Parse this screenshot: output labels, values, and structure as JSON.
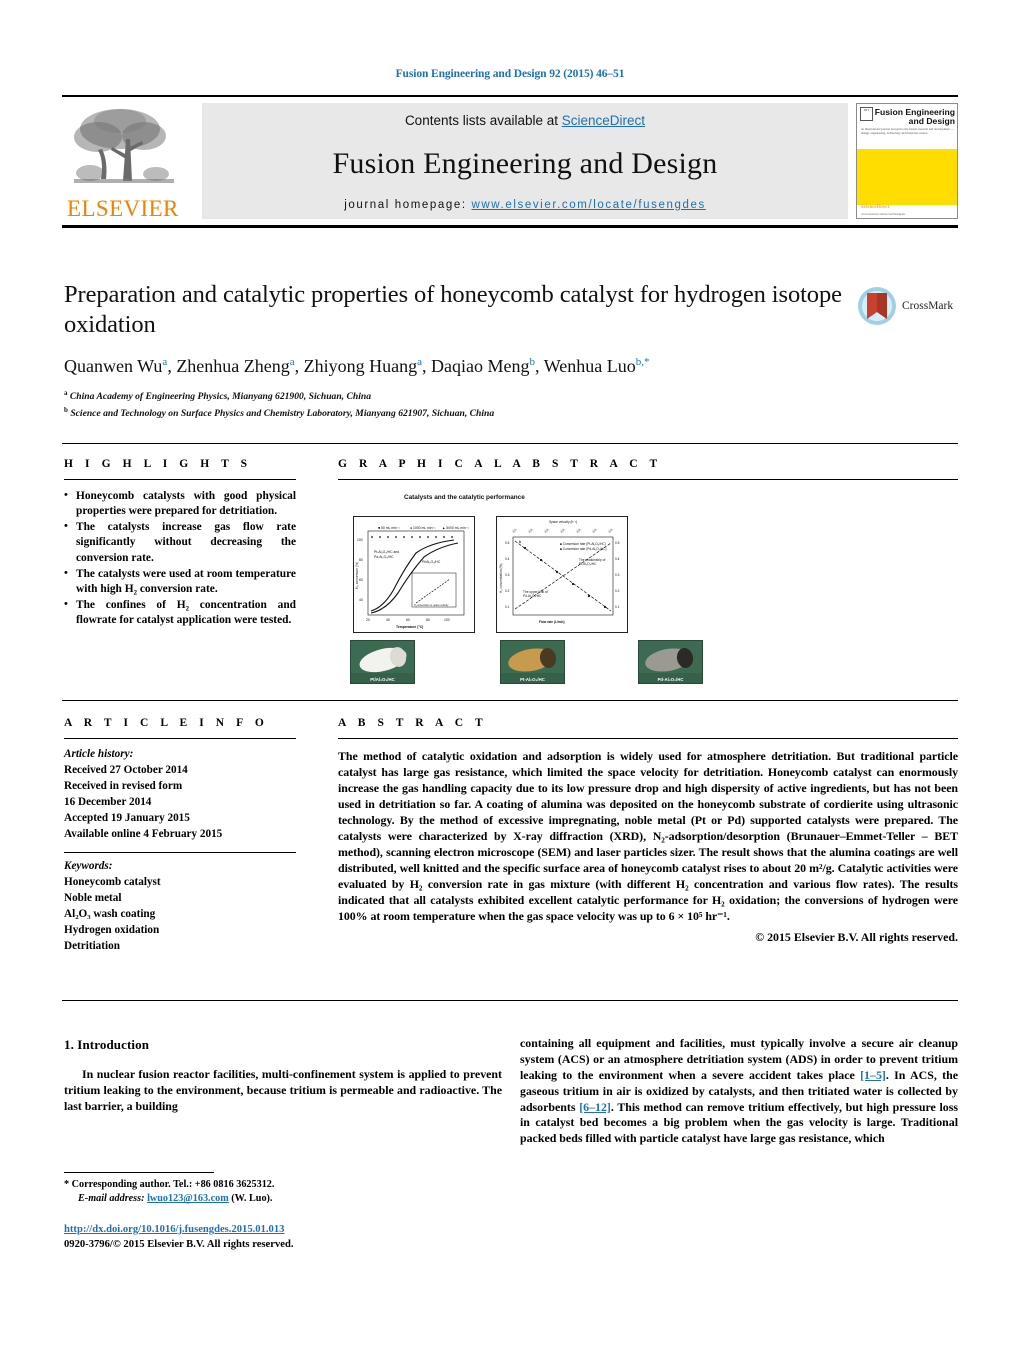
{
  "running_head": "Fusion Engineering and Design 92 (2015) 46–51",
  "masthead": {
    "contents_prefix": "Contents lists available at ",
    "sciencedirect": "ScienceDirect",
    "journal_title": "Fusion Engineering and Design",
    "homepage_prefix": "journal homepage: ",
    "homepage_url": "www.elsevier.com/locate/fusengdes",
    "publisher": "ELSEVIER",
    "cover": {
      "title_line1": "Fusion Engineering",
      "title_line2": "and Design",
      "badge": "INT",
      "subtext": "an International journal devoted to the fusion research and development — design, engineering, technology and materials science",
      "foot_brand": "ScienceDirect",
      "foot_url": "www.elsevier.com/locate/fusengdes"
    },
    "colors": {
      "link": "#1c70b6",
      "elsevier_orange": "#ef8200",
      "cover_yellow": "#ffdd00",
      "panel_gray": "#e8e8e8"
    }
  },
  "article": {
    "title": "Preparation and catalytic properties of honeycomb catalyst for hydrogen isotope oxidation",
    "authors_html": "Quanwen Wu<sup>a</sup>, Zhenhua Zheng<sup>a</sup>, Zhiyong Huang<sup>a</sup>, Daqiao Meng<sup>b</sup>, Wenhua Luo<sup>b,*</sup>",
    "affiliations": [
      "China Academy of Engineering Physics, Mianyang 621900, Sichuan, China",
      "Science and Technology on Surface Physics and Chemistry Laboratory, Mianyang 621907, Sichuan, China"
    ],
    "crossmark_label": "CrossMark"
  },
  "highlights": {
    "heading": "H I G H L I G H T S",
    "items": [
      "Honeycomb catalysts with good physical properties were prepared for detritiation.",
      "The catalysts increase gas flow rate significantly without decreasing the conversion rate.",
      "The catalysts were used at room temperature with high H₂ conversion rate.",
      "The confines of H₂ concentration and flowrate for catalyst application were tested."
    ]
  },
  "graphical_abstract": {
    "heading": "G R A P H I C A L   A B S T R A C T",
    "figure_title": "Catalysts and the catalytic performance",
    "left_plot": {
      "xlabel": "Temperature (°C)",
      "ylabel": "H₂ conversion (%)",
      "legend": [
        "50 mL min⁻¹",
        "1000 mL min⁻¹",
        "5000 mL min⁻¹"
      ],
      "annotations": [
        "Pt-Al₂O₃/HC and Pd-Al₂O₃/HC",
        "Pt/Al₂O₃/HC"
      ]
    },
    "right_plot": {
      "xlabel": "Flow rate (L/min)",
      "ylabel": "H₂ concentration (%)",
      "top_axis": "Space velocity (h⁻¹)",
      "top_ticks": [
        "10⁴",
        "10⁵",
        "10⁵",
        "10⁵",
        "10⁵",
        "10⁶",
        "10⁶"
      ],
      "legend": [
        "Conversion rate (Pt-Al₂O₃/HC)",
        "Conversion rate (Pd-Al₂O₃/HC)"
      ],
      "annotations": [
        "The relationship of Pt-Al₂O₃/HC",
        "The upper limit of Pd-Al₂O₃/HC"
      ]
    },
    "photos": [
      {
        "caption": "Pt/Al₂O₃/HC"
      },
      {
        "caption": "Pt-Al₂O₃/HC"
      },
      {
        "caption": "Pd-Al₂O₃/HC"
      }
    ]
  },
  "article_info": {
    "heading": "A R T I C L E   I N F O",
    "history_label": "Article history:",
    "history": [
      "Received 27 October 2014",
      "Received in revised form",
      "16 December 2014",
      "Accepted 19 January 2015",
      "Available online 4 February 2015"
    ],
    "keywords_label": "Keywords:",
    "keywords": [
      "Honeycomb catalyst",
      "Noble metal",
      "Al₂O₃ wash coating",
      "Hydrogen oxidation",
      "Detritiation"
    ]
  },
  "abstract": {
    "heading": "A B S T R A C T",
    "text": "The method of catalytic oxidation and adsorption is widely used for atmosphere detritiation. But traditional particle catalyst has large gas resistance, which limited the space velocity for detritiation. Honeycomb catalyst can enormously increase the gas handling capacity due to its low pressure drop and high dispersity of active ingredients, but has not been used in detritiation so far. A coating of alumina was deposited on the honeycomb substrate of cordierite using ultrasonic technology. By the method of excessive impregnating, noble metal (Pt or Pd) supported catalysts were prepared. The catalysts were characterized by X-ray diffraction (XRD), N₂-adsorption/desorption (Brunauer–Emmet-Teller – BET method), scanning electron microscope (SEM) and laser particles sizer. The result shows that the alumina coatings are well distributed, well knitted and the specific surface area of honeycomb catalyst rises to about 20 m²/g. Catalytic activities were evaluated by H₂ conversion rate in gas mixture (with different H₂ concentration and various flow rates). The results indicated that all catalysts exhibited excellent catalytic performance for H₂ oxidation; the conversions of hydrogen were 100% at room temperature when the gas space velocity was up to 6 × 10⁵ hr⁻¹.",
    "copyright": "© 2015 Elsevier B.V. All rights reserved."
  },
  "body": {
    "section_title": "1.  Introduction",
    "left_paragraph": "In nuclear fusion reactor facilities, multi-confinement system is applied to prevent tritium leaking to the environment, because tritium is permeable and radioactive. The last barrier, a building",
    "right_paragraph_part1": "containing all equipment and facilities, must typically involve a secure air cleanup system (ACS) or an atmosphere detritiation system (ADS) in order to prevent tritium leaking to the environment when a severe accident takes place ",
    "ref1": "[1–5]",
    "right_paragraph_part2": ". In ACS, the gaseous tritium in air is oxidized by catalysts, and then tritiated water is collected by adsorbents ",
    "ref2": "[6–12]",
    "right_paragraph_part3": ". This method can remove tritium effectively, but high pressure loss in catalyst bed becomes a big problem when the gas velocity is large. Traditional packed beds filled with particle catalyst have large gas resistance, which"
  },
  "footer": {
    "corresponding_marker": "*",
    "corresponding_text": "Corresponding author. Tel.: +86 0816 3625312.",
    "email_label": "E-mail address:",
    "email": "lwuo123@163.com",
    "email_suffix": "(W. Luo).",
    "doi": "http://dx.doi.org/10.1016/j.fusengdes.2015.01.013",
    "issn_line": "0920-3796/© 2015 Elsevier B.V. All rights reserved."
  }
}
